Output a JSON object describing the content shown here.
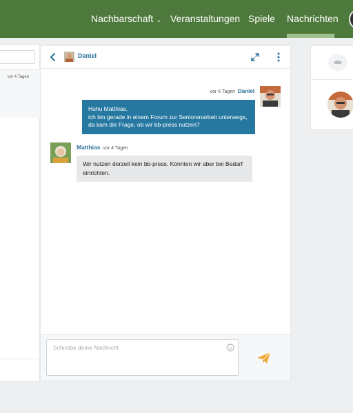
{
  "nav": {
    "items": [
      {
        "label": "Nachbarschaft",
        "has_dropdown": true
      },
      {
        "label": "Veranstaltungen"
      },
      {
        "label": "Spiele"
      },
      {
        "label": "Nachrichten",
        "active": true
      }
    ]
  },
  "conversation_list": {
    "items": [
      {
        "time": "vor 4 Tagen",
        "selected": true
      }
    ]
  },
  "chat": {
    "header": {
      "name": "Daniel"
    },
    "messages": [
      {
        "time": "vor 6 Tagen",
        "author": "Daniel",
        "text": "Huhu Matthias,\nich bin gerade in einem Forum zur Seniorenarbeit unterwegs, da kam die Frage, ob wir bb-press nutzen?",
        "outgoing": true
      },
      {
        "time": "vor 4 Tagen",
        "author": "Matthias",
        "text": "Wir nutzen derzeit kein bb-press. Könnten wir aber bei Bedarf einrichten.",
        "outgoing": false
      }
    ],
    "composer": {
      "placeholder": "Schreibe deine Nachricht"
    }
  },
  "colors": {
    "nav_bg": "#4d7a3c",
    "accent_blue": "#2678a0",
    "link_blue": "#2a6f9a",
    "send_orange": "#f0a830"
  }
}
